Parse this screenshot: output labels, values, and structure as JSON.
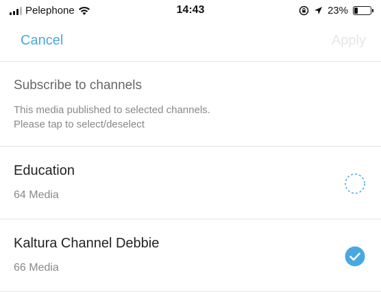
{
  "status": {
    "carrier": "Pelephone",
    "time": "14:43",
    "battery": "23%",
    "battery_level": 0.23
  },
  "nav": {
    "cancel_label": "Cancel",
    "apply_label": "Apply"
  },
  "header": {
    "title": "Subscribe to channels",
    "description": "This media published to selected channels.\nPlease tap to select/deselect"
  },
  "channels": [
    {
      "name": "Education",
      "count": "64 Media",
      "selected": false
    },
    {
      "name": "Kaltura Channel Debbie",
      "count": "66 Media",
      "selected": true
    }
  ],
  "colors": {
    "accent": "#4aa8e0",
    "disabled": "#e6e6e6",
    "divider": "#e3e3e3"
  }
}
